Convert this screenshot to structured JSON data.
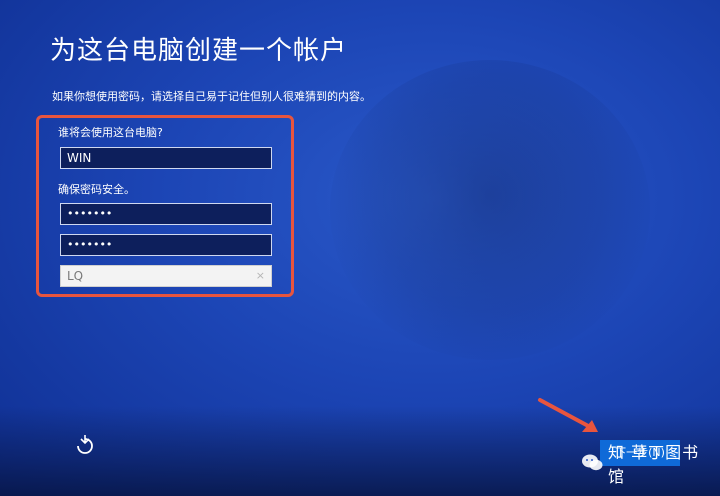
{
  "page": {
    "title": "为这台电脑创建一个帐户",
    "subtitle": "如果你想使用密码，请选择自己易于记住但别人很难猜到的内容。"
  },
  "form": {
    "username_label": "谁将会使用这台电脑?",
    "username_value": "WIN",
    "password_label": "确保密码安全。",
    "password_value": "•••••••",
    "confirm_password_value": "•••••••",
    "hint_value": "LQ",
    "hint_clear_symbol": "×"
  },
  "footer": {
    "next_button_label": "下一步(N)",
    "accessibility_icon": "accessibility-icon"
  },
  "watermark": {
    "icon": "wechat-icon",
    "text": "知 草丁图书馆"
  },
  "colors": {
    "background": "#1c45b5",
    "highlight_border": "#e8553e",
    "field_dark": "#0d1f5c",
    "arrow": "#e8553e"
  }
}
